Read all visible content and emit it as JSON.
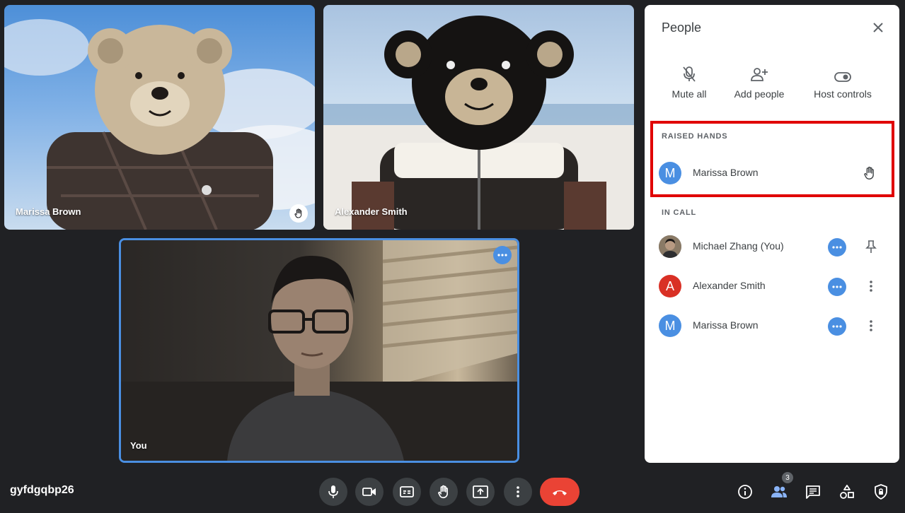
{
  "meeting": {
    "code": "gyfdgqbp26"
  },
  "tiles": [
    {
      "name": "Marissa Brown",
      "hand_raised": true
    },
    {
      "name": "Alexander Smith"
    },
    {
      "name": "You"
    }
  ],
  "people_panel": {
    "title": "People",
    "actions": [
      {
        "label": "Mute all",
        "icon": "mic-off-icon"
      },
      {
        "label": "Add people",
        "icon": "person-add-icon"
      },
      {
        "label": "Host controls",
        "icon": "toggle-icon"
      }
    ],
    "raised_hands": {
      "label": "RAISED HANDS",
      "people": [
        {
          "name": "Marissa Brown",
          "initial": "M",
          "color": "#4a8fe2"
        }
      ]
    },
    "in_call": {
      "label": "IN CALL",
      "people": [
        {
          "name": "Michael Zhang (You)",
          "initial": "",
          "color": "#5f6368",
          "action_icon": "pin-icon"
        },
        {
          "name": "Alexander Smith",
          "initial": "A",
          "color": "#d93025",
          "action_icon": "more-vert-icon"
        },
        {
          "name": "Marissa Brown",
          "initial": "M",
          "color": "#4a8fe2",
          "action_icon": "more-vert-icon"
        }
      ]
    }
  },
  "controls": [
    "mic-icon",
    "camera-icon",
    "captions-icon",
    "raise-hand-icon",
    "present-icon",
    "more-vert-icon",
    "end-call-icon"
  ],
  "right_controls": {
    "icons": [
      "info-icon",
      "people-icon",
      "chat-icon",
      "activities-icon",
      "host-lock-icon"
    ],
    "people_count": "3"
  },
  "colors": {
    "accent": "#4a8fe2",
    "end_call": "#ea4335",
    "highlight": "#e00000"
  }
}
